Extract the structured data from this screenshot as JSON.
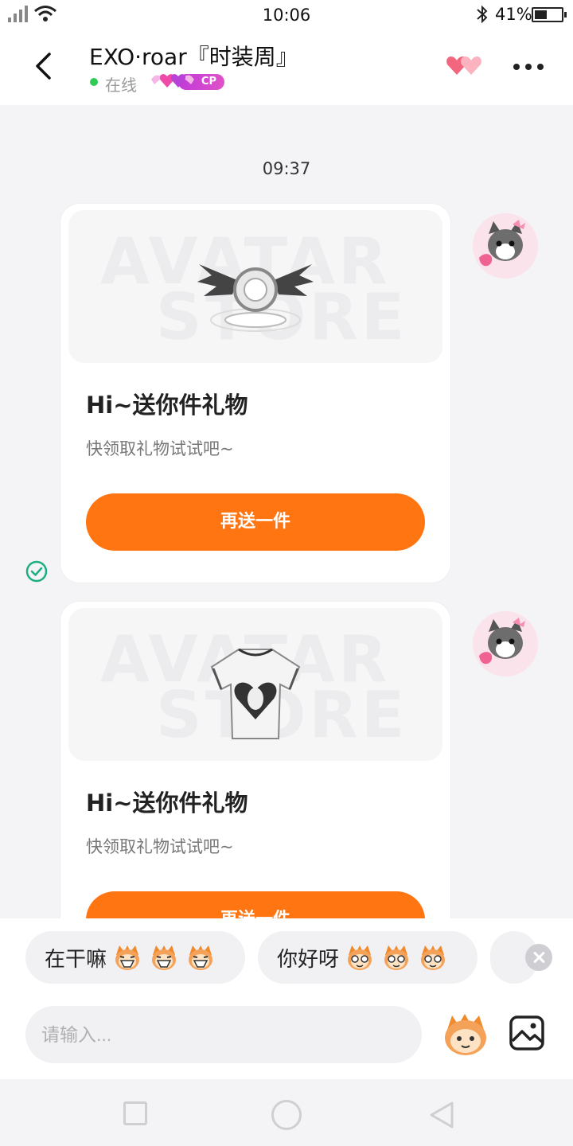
{
  "status_bar": {
    "time": "10:06",
    "battery": "41%",
    "battery_fraction": 0.41
  },
  "header": {
    "title": "EXO·roar『时装周』",
    "status": "在线",
    "badge": "CP"
  },
  "chat": {
    "timestamp": "09:37",
    "cards": [
      {
        "title": "Hi~送你件礼物",
        "subtitle": "快领取礼物试试吧~",
        "button": "再送一件",
        "watermark_top": "AVATAR",
        "watermark_bottom": "STORE",
        "item_icon": "winged-ring-icon"
      },
      {
        "title": "Hi~送你件礼物",
        "subtitle": "快领取礼物试试吧~",
        "button": "再送一件",
        "watermark_top": "AVATAR",
        "watermark_bottom": "STORE",
        "item_icon": "tshirt-icon"
      }
    ]
  },
  "quick_replies": [
    {
      "text": "在干嘛"
    },
    {
      "text": "你好呀"
    }
  ],
  "input": {
    "placeholder": "请输入..."
  },
  "colors": {
    "accent": "#ff7512",
    "online": "#2ecc55",
    "cp_badge": "#c03ad8",
    "check": "#1cae82"
  }
}
